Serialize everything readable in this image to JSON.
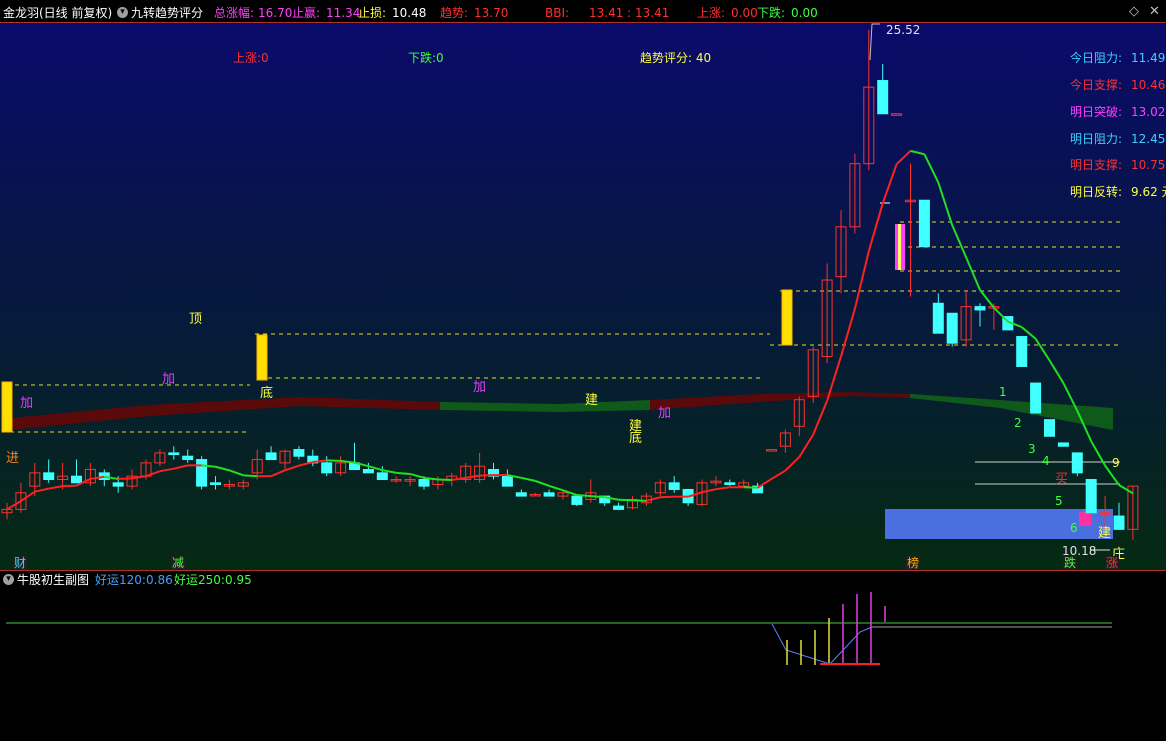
{
  "header": {
    "stock_name": "金龙羽(日线 前复权)",
    "indicator_name": "九转趋势评分",
    "stats": [
      {
        "label": "总涨幅: ",
        "value": "16.70",
        "color": "#ff40ff"
      },
      {
        "label": "止赢: ",
        "value": "11.34",
        "color": "#ff40ff"
      },
      {
        "label": "止损: ",
        "value": "10.48",
        "color": "#ffff40"
      },
      {
        "label": "趋势: ",
        "value": "13.70",
        "color": "#ff3030"
      },
      {
        "label": "BBI: ",
        "value": "13.41 : 13.41",
        "color": "#ff3030"
      },
      {
        "label": "上涨: ",
        "value": "0.00",
        "color": "#ff3030"
      },
      {
        "label": "下跌: ",
        "value": "0.00",
        "color": "#40ff40"
      }
    ]
  },
  "main_labels": {
    "up_count": "上涨:0",
    "down_count": "下跌:0",
    "trend_score": "趋势评分:  40",
    "peak_price": "25.52",
    "low_price": "10.18"
  },
  "levels": [
    {
      "label": "今日阻力: ",
      "value": "11.49",
      "color": "#40d0ff"
    },
    {
      "label": "今日支撑: ",
      "value": "10.46",
      "color": "#ff3030"
    },
    {
      "label": "明日突破: ",
      "value": "13.02",
      "color": "#ff40ff"
    },
    {
      "label": "明日阻力: ",
      "value": "12.45",
      "color": "#40d0ff"
    },
    {
      "label": "明日支撑: ",
      "value": "10.75",
      "color": "#ff3030"
    },
    {
      "label": "明日反转: ",
      "value": "9.62 元",
      "color": "#ffff40"
    }
  ],
  "signals": [
    {
      "text": "加",
      "color": "#e040ff"
    },
    {
      "text": "进",
      "color": "#ff8020"
    },
    {
      "text": "顶",
      "color": "#ffff40"
    },
    {
      "text": "加",
      "color": "#e040ff"
    },
    {
      "text": "底",
      "color": "#ffff40"
    },
    {
      "text": "加",
      "color": "#e040ff"
    },
    {
      "text": "建",
      "color": "#ffff40"
    },
    {
      "text": "建",
      "color": "#ffff40"
    },
    {
      "text": "底",
      "color": "#ffff40"
    },
    {
      "text": "加",
      "color": "#e040ff"
    },
    {
      "text": "建",
      "color": "#ffff40"
    },
    {
      "text": "买",
      "color": "#ff3030"
    },
    {
      "text": "庄",
      "color": "#ffff40"
    }
  ],
  "countdown": [
    "1",
    "2",
    "3",
    "4",
    "5",
    "6",
    "9"
  ],
  "bottom_tags": [
    {
      "text": "财",
      "color": "#40d0ff"
    },
    {
      "text": "减",
      "color": "#40ff40"
    },
    {
      "text": "榜",
      "color": "#ffb000"
    },
    {
      "text": "跌",
      "color": "#40ff40"
    },
    {
      "text": "涨",
      "color": "#ff3030"
    }
  ],
  "sub_panel": {
    "title": "牛股初生副图",
    "items": [
      {
        "label": "好运120: ",
        "value": "0.86",
        "color": "#40a0ff"
      },
      {
        "label": "好运250: ",
        "value": "0.95",
        "color": "#40ff40"
      }
    ]
  },
  "colors": {
    "up": "#ff3030",
    "down": "#40ffff",
    "ma_up": "#ff2020",
    "ma_down": "#20e020",
    "dash": "#e0e020"
  },
  "chart_data": {
    "type": "candlestick",
    "title": "",
    "ohlc": [
      [
        11.0,
        11.3,
        10.8,
        11.1
      ],
      [
        11.1,
        11.9,
        11.0,
        11.6
      ],
      [
        11.8,
        12.5,
        11.5,
        12.2
      ],
      [
        12.2,
        12.6,
        11.9,
        12.0
      ],
      [
        12.0,
        12.5,
        11.7,
        12.1
      ],
      [
        12.1,
        12.6,
        11.9,
        11.9
      ],
      [
        11.9,
        12.5,
        11.8,
        12.3
      ],
      [
        12.2,
        12.3,
        11.8,
        12.0
      ],
      [
        11.9,
        12.1,
        11.6,
        11.8
      ],
      [
        11.8,
        12.3,
        11.7,
        12.1
      ],
      [
        12.1,
        12.6,
        12.0,
        12.5
      ],
      [
        12.5,
        12.9,
        12.4,
        12.8
      ],
      [
        12.8,
        13.0,
        12.6,
        12.75
      ],
      [
        12.7,
        12.9,
        12.5,
        12.6
      ],
      [
        12.6,
        12.7,
        11.7,
        11.8
      ],
      [
        11.9,
        12.1,
        11.7,
        11.85
      ],
      [
        11.8,
        12.0,
        11.7,
        11.85
      ],
      [
        11.8,
        12.0,
        11.7,
        11.9
      ],
      [
        12.2,
        12.9,
        12.0,
        12.6
      ],
      [
        12.8,
        13.0,
        12.6,
        12.6
      ],
      [
        12.5,
        12.9,
        12.3,
        12.85
      ],
      [
        12.9,
        13.0,
        12.6,
        12.7
      ],
      [
        12.7,
        12.9,
        12.4,
        12.5
      ],
      [
        12.5,
        12.7,
        12.1,
        12.2
      ],
      [
        12.2,
        12.7,
        12.1,
        12.5
      ],
      [
        12.5,
        13.1,
        12.4,
        12.3
      ],
      [
        12.3,
        12.5,
        12.2,
        12.2
      ],
      [
        12.2,
        12.4,
        12.0,
        12.0
      ],
      [
        12.0,
        12.1,
        11.9,
        12.0
      ],
      [
        11.95,
        12.1,
        11.8,
        12.0
      ],
      [
        12.0,
        12.1,
        11.7,
        11.8
      ],
      [
        11.85,
        12.1,
        11.7,
        12.0
      ],
      [
        12.0,
        12.2,
        11.8,
        12.1
      ],
      [
        12.0,
        12.5,
        11.9,
        12.4
      ],
      [
        12.0,
        12.8,
        11.9,
        12.4
      ],
      [
        12.3,
        12.5,
        12.0,
        12.1
      ],
      [
        12.1,
        12.3,
        11.8,
        11.8
      ],
      [
        11.6,
        11.7,
        11.5,
        11.5
      ],
      [
        11.55,
        11.6,
        11.5,
        11.55
      ],
      [
        11.6,
        11.7,
        11.5,
        11.5
      ],
      [
        11.5,
        11.7,
        11.4,
        11.6
      ],
      [
        11.5,
        11.5,
        11.2,
        11.25
      ],
      [
        11.4,
        12.0,
        11.3,
        11.6
      ],
      [
        11.5,
        11.5,
        11.2,
        11.3
      ],
      [
        11.2,
        11.3,
        11.1,
        11.1
      ],
      [
        11.15,
        11.5,
        11.1,
        11.4
      ],
      [
        11.3,
        11.6,
        11.2,
        11.5
      ],
      [
        11.6,
        12.0,
        11.5,
        11.9
      ],
      [
        11.9,
        12.1,
        11.6,
        11.7
      ],
      [
        11.7,
        11.7,
        11.2,
        11.3
      ],
      [
        11.25,
        12.0,
        11.2,
        11.9
      ],
      [
        11.9,
        12.1,
        11.8,
        11.95
      ],
      [
        11.9,
        12.0,
        11.8,
        11.85
      ],
      [
        11.8,
        12.0,
        11.8,
        11.9
      ],
      [
        11.8,
        11.9,
        11.6,
        11.6
      ],
      [
        12.9,
        12.9,
        12.9,
        12.9
      ],
      [
        13.0,
        13.5,
        12.8,
        13.4
      ],
      [
        13.6,
        14.5,
        13.3,
        14.4
      ],
      [
        14.5,
        16.0,
        14.3,
        15.9
      ],
      [
        15.7,
        18.5,
        15.5,
        18.0
      ],
      [
        18.1,
        20.1,
        17.6,
        19.6
      ],
      [
        19.6,
        21.8,
        19.4,
        21.5
      ],
      [
        21.5,
        25.52,
        21.3,
        23.8
      ],
      [
        24.0,
        24.5,
        23.0,
        23.0
      ],
      [
        23.0,
        23.0,
        23.0,
        23.0
      ],
      [
        20.4,
        21.5,
        17.5,
        20.4
      ],
      [
        20.4,
        20.4,
        19.0,
        19.0
      ],
      [
        17.3,
        17.6,
        16.4,
        16.4
      ],
      [
        17.0,
        17.0,
        16.0,
        16.1
      ],
      [
        16.2,
        17.7,
        16.0,
        17.2
      ],
      [
        17.2,
        17.3,
        16.6,
        17.1
      ],
      [
        17.2,
        17.3,
        16.5,
        17.2
      ],
      [
        16.9,
        16.9,
        16.6,
        16.5
      ],
      [
        16.3,
        16.3,
        15.5,
        15.4
      ],
      [
        14.9,
        14.9,
        14.1,
        14.0
      ],
      [
        13.8,
        13.8,
        13.3,
        13.3
      ],
      [
        13.1,
        13.1,
        13.0,
        13.0
      ],
      [
        12.8,
        12.8,
        12.1,
        12.2
      ],
      [
        12.0,
        12.0,
        11.2,
        11.0
      ],
      [
        11.0,
        11.5,
        10.5,
        11.0
      ],
      [
        10.9,
        11.3,
        10.5,
        10.5
      ],
      [
        10.5,
        11.8,
        10.18,
        11.8
      ]
    ],
    "levels": {
      "today_resistance": 11.49,
      "today_support": 10.46,
      "tomorrow_breakout": 13.02,
      "tomorrow_resistance": 12.45,
      "tomorrow_support": 10.75,
      "tomorrow_reversal": 9.62
    },
    "annotations": {
      "peak": 25.52,
      "low": 10.18
    }
  }
}
